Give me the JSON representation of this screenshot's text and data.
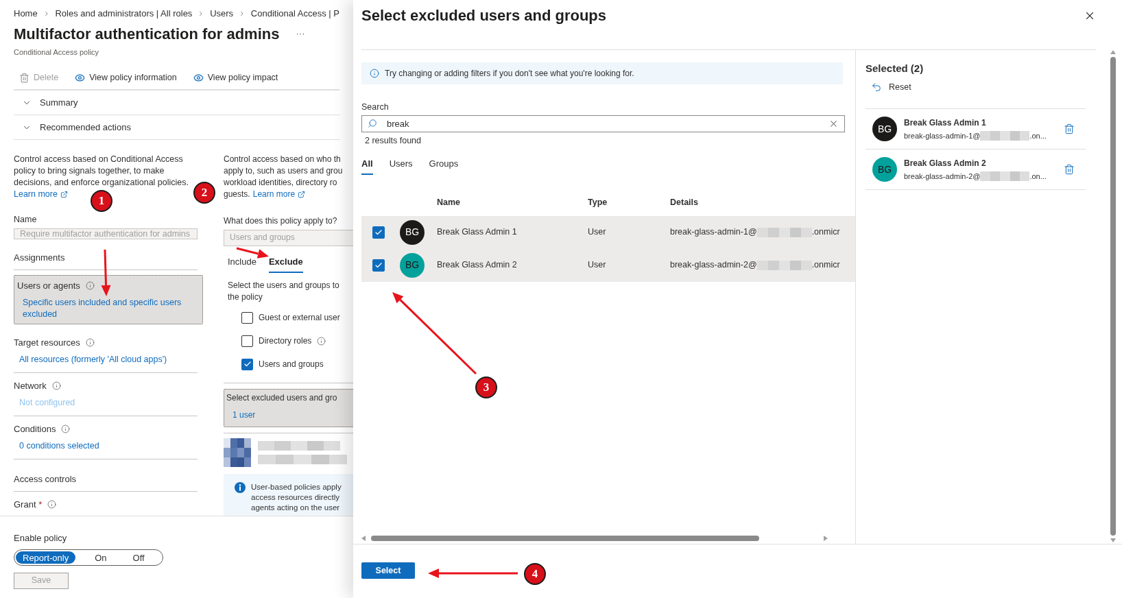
{
  "breadcrumb": [
    "Home",
    "Roles and administrators | All roles",
    "Users",
    "Conditional Access | P"
  ],
  "page": {
    "title": "Multifactor authentication for admins",
    "more": "···",
    "subtitle": "Conditional Access policy"
  },
  "toolbar": [
    {
      "label": "Delete",
      "kind": "delete",
      "disabled": true
    },
    {
      "label": "View policy information",
      "kind": "view",
      "disabled": false
    },
    {
      "label": "View policy impact",
      "kind": "view",
      "disabled": false
    }
  ],
  "collapsibles": [
    {
      "label": "Summary",
      "expanded": false
    },
    {
      "label": "Recommended actions",
      "expanded": false
    }
  ],
  "overview": {
    "text": "Control access based on Conditional Access policy to bring signals together, to make decisions, and enforce organizational policies.",
    "link": "Learn more"
  },
  "name_field": {
    "label": "Name",
    "value": "Require multifactor authentication for admins",
    "disabled": true
  },
  "sections": [
    {
      "kind": "heading",
      "title": "Assignments"
    },
    {
      "kind": "field",
      "title": "Users or agents",
      "value": "Specific users included and specific users excluded",
      "selected": true,
      "dimmed": false
    },
    {
      "kind": "field",
      "title": "Target resources",
      "value": "All resources (formerly 'All cloud apps')",
      "selected": false,
      "dimmed": false
    },
    {
      "kind": "field",
      "title": "Network",
      "value": "Not configured",
      "selected": false,
      "dimmed": true
    },
    {
      "kind": "field",
      "title": "Conditions",
      "value": "0 conditions selected",
      "selected": false,
      "dimmed": false
    },
    {
      "kind": "heading",
      "title": "Access controls"
    },
    {
      "kind": "field",
      "title": "Grant",
      "required_mark": "*",
      "selected": false
    }
  ],
  "assignment_detail": {
    "lines": [
      "Control access based on who th",
      "apply to, such as users and grou",
      "workload identities, directory ro",
      "guests."
    ],
    "link": "Learn more",
    "apply_label": "What does this policy apply to?",
    "apply_value": "Users and groups",
    "tabs": [
      {
        "label": "Include",
        "selected": false
      },
      {
        "label": "Exclude",
        "selected": true
      }
    ],
    "instruction_lines": [
      "Select the users and groups to",
      "the policy"
    ],
    "options": [
      {
        "label": "Guest or external user",
        "checked": false,
        "info": false
      },
      {
        "label": "Directory roles",
        "checked": false,
        "info": true
      },
      {
        "label": "Users and groups",
        "checked": true,
        "info": false
      }
    ],
    "picker": {
      "label": "Select excluded users and gro",
      "value": "1 user"
    },
    "notice_lines": [
      "User-based policies apply",
      "access resources directly",
      "agents acting on the user"
    ]
  },
  "footer": {
    "label": "Enable policy",
    "options": [
      {
        "label": "Report-only",
        "selected": true
      },
      {
        "label": "On",
        "selected": false
      },
      {
        "label": "Off",
        "selected": false
      }
    ],
    "save": {
      "label": "Save",
      "disabled": true
    }
  },
  "panel": {
    "title": "Select excluded users and groups",
    "notice": "Try changing or adding filters if you don't see what you're looking for.",
    "search": {
      "label": "Search",
      "value": "break",
      "result_count": "2 results found"
    },
    "tabs": [
      {
        "label": "All",
        "selected": true
      },
      {
        "label": "Users",
        "selected": false
      },
      {
        "label": "Groups",
        "selected": false
      }
    ],
    "columns": [
      "Name",
      "Type",
      "Details"
    ],
    "rows": [
      {
        "initials": "BG",
        "color": "#1b1a19",
        "name": "Break Glass Admin 1",
        "type": "User",
        "details_prefix": "break-glass-admin-1@",
        "details_suffix": ".onmicr",
        "checked": true
      },
      {
        "initials": "BG",
        "color": "#03a19c",
        "name": "Break Glass Admin 2",
        "type": "User",
        "details_prefix": "break-glass-admin-2@",
        "details_suffix": ".onmicr",
        "checked": true
      }
    ],
    "selected": {
      "title": "Selected (2)",
      "reset": "Reset",
      "items": [
        {
          "initials": "BG",
          "color": "#1b1a19",
          "name": "Break Glass Admin 1",
          "email_prefix": "break-glass-admin-1@",
          "email_suffix": ".on..."
        },
        {
          "initials": "BG",
          "color": "#03a19c",
          "name": "Break Glass Admin 2",
          "email_prefix": "break-glass-admin-2@",
          "email_suffix": ".on..."
        }
      ]
    },
    "select_button": "Select"
  },
  "annotations": [
    {
      "label": "1"
    },
    {
      "label": "2"
    },
    {
      "label": "3"
    },
    {
      "label": "4"
    }
  ]
}
